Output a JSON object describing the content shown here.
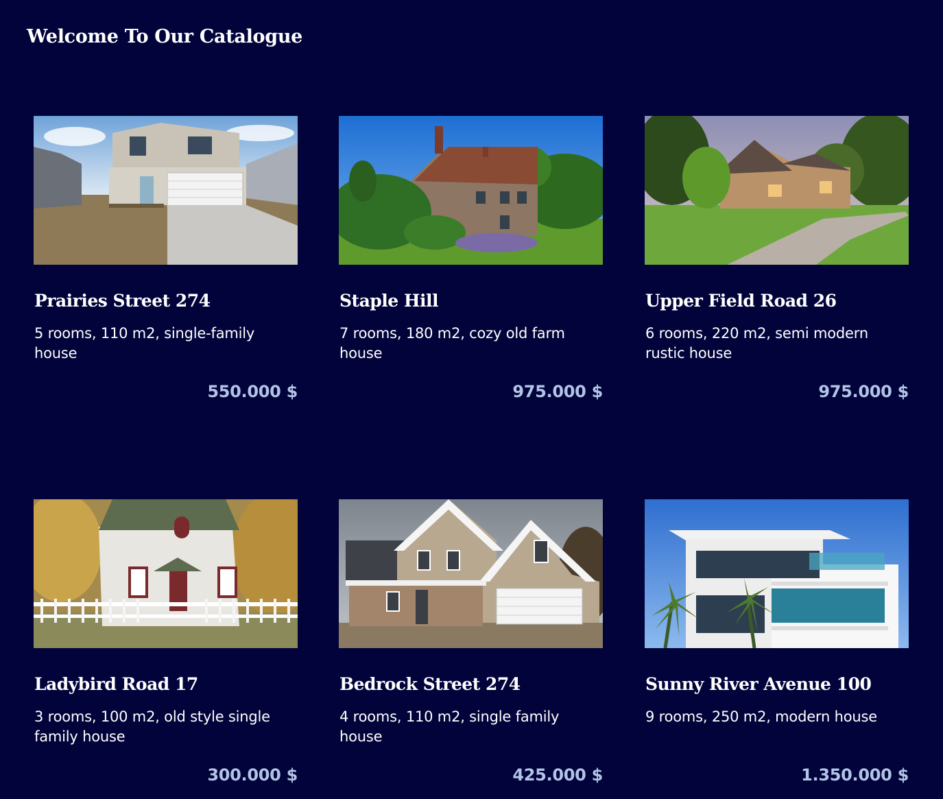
{
  "page": {
    "title": "Welcome To Our Catalogue",
    "background_color": "#01033a",
    "price_color": "#b3c4e6"
  },
  "listings": [
    {
      "name": "Prairies Street 274",
      "description": "5 rooms, 110 m2, single-family house",
      "price": "550.000 $",
      "image": "modern-suburban-house-with-garage-photo"
    },
    {
      "name": "Staple Hill",
      "description": "7 rooms, 180 m2, cozy old farm house",
      "price": "975.000 $",
      "image": "old-stone-farm-house-photo"
    },
    {
      "name": "Upper Field Road 26",
      "description": "6 rooms, 220 m2, semi modern rustic house",
      "price": "975.000 $",
      "image": "rustic-house-with-driveway-photo"
    },
    {
      "name": "Ladybird Road 17",
      "description": "3 rooms, 100 m2, old style single family house",
      "price": "300.000 $",
      "image": "white-cottage-with-picket-fence-photo"
    },
    {
      "name": "Bedrock Street 274",
      "description": "4 rooms, 110 m2, single family house",
      "price": "425.000 $",
      "image": "two-story-family-house-with-garage-photo"
    },
    {
      "name": "Sunny River Avenue 100",
      "description": "9 rooms, 250 m2, modern house",
      "price": "1.350.000 $",
      "image": "modern-white-villa-with-palms-photo"
    }
  ]
}
